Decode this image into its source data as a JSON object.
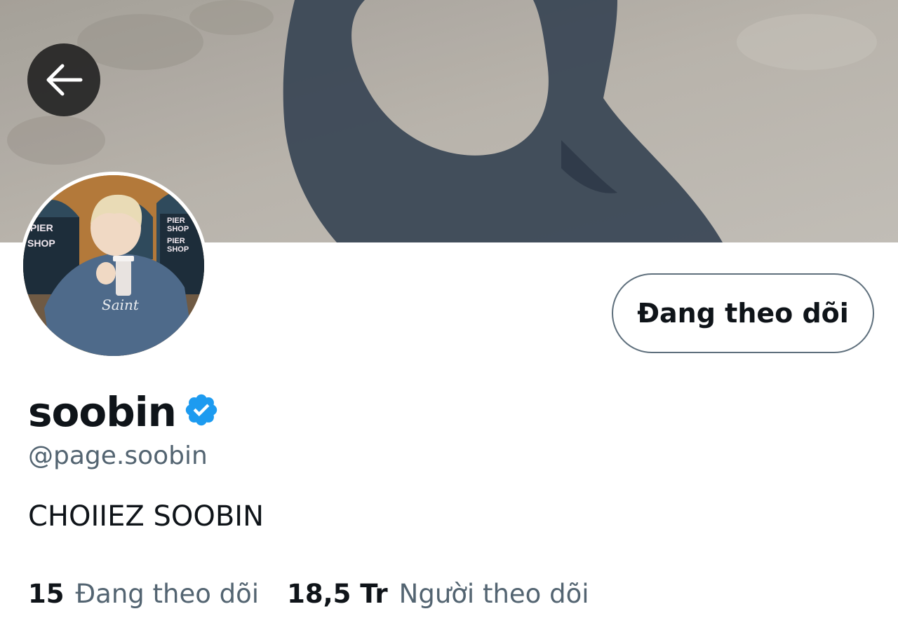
{
  "header": {
    "back_icon": "arrow-left-icon"
  },
  "profile": {
    "display_name": "soobin",
    "verified_icon": "verified-badge-icon",
    "verified_color": "#1d9bf0",
    "handle": "@page.soobin",
    "bio": "CHOIIEZ SOOBIN",
    "follow_button_label": "Đang theo dõi",
    "avatar_sign_text": [
      "PIER",
      "SHOP",
      "PIER",
      "SHOP",
      "PIER",
      "SHOP"
    ],
    "shirt_text": "Saint"
  },
  "stats": {
    "following": {
      "value": "15",
      "label": "Đang theo dõi"
    },
    "followers": {
      "value": "18,5 Tr",
      "label": "Người theo dõi"
    }
  },
  "colors": {
    "text_primary": "#0f1419",
    "text_secondary": "#536471",
    "button_border": "#5e6f7c"
  }
}
